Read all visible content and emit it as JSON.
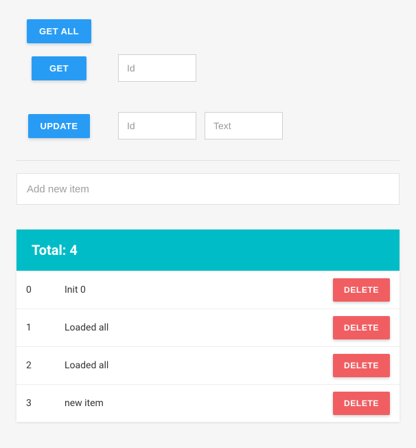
{
  "actions": {
    "get_all": "GET ALL",
    "get": "GET",
    "update": "UPDATE"
  },
  "inputs": {
    "get_id_placeholder": "Id",
    "update_id_placeholder": "Id",
    "update_text_placeholder": "Text",
    "add_placeholder": "Add new item"
  },
  "list": {
    "header_prefix": "Total: ",
    "total": "4",
    "delete_label": "DELETE",
    "items": [
      {
        "id": "0",
        "text": "Init 0"
      },
      {
        "id": "1",
        "text": "Loaded all"
      },
      {
        "id": "2",
        "text": "Loaded all"
      },
      {
        "id": "3",
        "text": "new item"
      }
    ]
  }
}
